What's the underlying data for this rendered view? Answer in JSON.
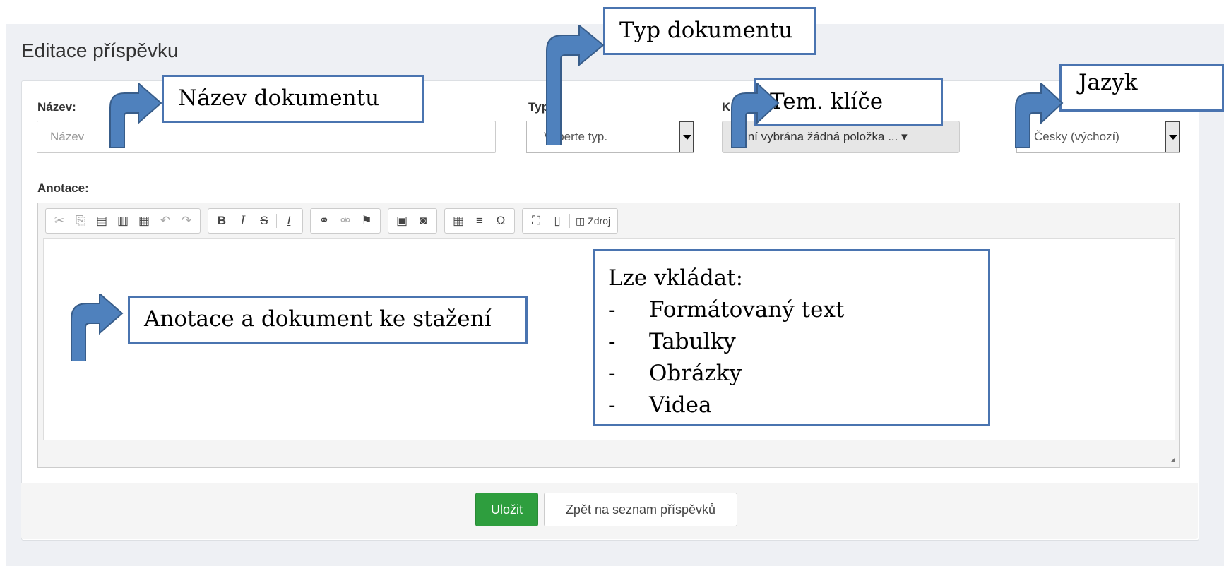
{
  "page": {
    "title": "Editace příspěvku"
  },
  "form": {
    "name_label": "Název:",
    "name_placeholder": "Název",
    "type_label": "Typ",
    "type_value": "Vyberte typ.",
    "keys_label": "K",
    "keys_value": "Není vybrána žádná položka ... ▾",
    "lang_value": "Česky (výchozí)",
    "annotation_label": "Anotace:"
  },
  "editor": {
    "toolbar": [
      [
        "cut-icon",
        "copy-icon",
        "paste-icon",
        "paste-text-icon",
        "paste-word-icon",
        "undo-icon",
        "redo-icon"
      ],
      [
        "bold-icon",
        "italic-icon",
        "strike-icon",
        "remove-format-icon"
      ],
      [
        "link-icon",
        "unlink-icon",
        "anchor-icon"
      ],
      [
        "image-icon",
        "flash-icon"
      ],
      [
        "table-icon",
        "hline-icon",
        "special-char-icon"
      ],
      [
        "maximize-icon",
        "show-blocks-icon"
      ]
    ],
    "source_label": "Zdroj"
  },
  "actions": {
    "save_label": "Uložit",
    "back_label": "Zpět na seznam příspěvků"
  },
  "callouts": {
    "name": "Název dokumentu",
    "type": "Typ dokumentu",
    "keys": "Tem. klíče",
    "lang": "Jazyk",
    "annotation": "Anotace a dokument ke stažení",
    "insert_title": "Lze vkládat:",
    "insert_items": [
      "Formátovaný text",
      "Tabulky",
      "Obrázky",
      "Videa"
    ],
    "bullet": "-"
  },
  "colors": {
    "callout_border": "#4a74b0",
    "arrow_fill": "#4f81bd",
    "save_button": "#2e9e3e"
  }
}
